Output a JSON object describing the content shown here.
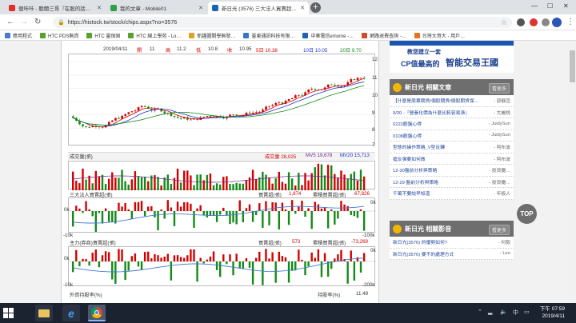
{
  "browser": {
    "tabs": [
      {
        "title": "個咔咔 - 聽爾三哥『在股的話…",
        "color": "#e52d27",
        "active": false
      },
      {
        "title": "我的文章 - Mobile01",
        "color": "#2f9e44",
        "active": false
      },
      {
        "title": "新日光 (3576) 三大法人買賣超…",
        "color": "#1b64b4",
        "active": true
      }
    ],
    "url": "https://histock.tw/stock/chips.aspx?no=3576",
    "bookmarks": [
      {
        "label": "應用程式",
        "color": "#4a7bd0"
      },
      {
        "label": "HTC PDS無資",
        "color": "#5aa02c"
      },
      {
        "label": "HTC 靈保固",
        "color": "#5aa02c"
      },
      {
        "label": "HTC 線上學苑 - Lo…",
        "color": "#5aa02c"
      },
      {
        "label": "新趣圖開學無發…",
        "color": "#e0a020"
      },
      {
        "label": "臺東通訊科技有限…",
        "color": "#3a73c9"
      },
      {
        "label": "中華電信emome -…",
        "color": "#1e61b8"
      },
      {
        "label": "網路退費查詢 -…",
        "color": "#d14b2f"
      },
      {
        "label": "台灣大哥大 - 用戶…",
        "color": "#e37222"
      }
    ]
  },
  "chart_header": {
    "date": "2019/04/11",
    "open_label": "開",
    "open": "11",
    "high_label": "高",
    "high": "11.2",
    "low_label": "低",
    "low": "10.8",
    "close_label": "收",
    "close": "10.95",
    "ma5": "5日 10.38",
    "ma10": "10日 10.05",
    "ma20": "20日 9.70"
  },
  "price_axis": [
    "12",
    "11",
    "10",
    "9",
    "8",
    "7",
    "6"
  ],
  "volume_panel": {
    "title": "成交量(張)",
    "vol": "成交量 28,025",
    "mv5": "MV5 19,678",
    "mv20": "MV20 15,713"
  },
  "institutional_panel": {
    "title": "三大法人買賣超(張)",
    "net_label": "買賣超(張)",
    "net_value": "1,874",
    "cum_label": "累積買賣超(張)",
    "cum_value": "67,826",
    "left_axis": "0k",
    "left_axis_low": "-10k",
    "right_axis": "0k",
    "right_axis_low": "-100k"
  },
  "major_panel": {
    "title": "主力(券商)買賣超(張)",
    "net_label": "買賣超(張)",
    "net_value": "573",
    "cum_label": "累積買賣超(張)",
    "cum_value": "-73,269",
    "left_axis": "0k",
    "left_axis_low": "-10k",
    "right_axis": "0k",
    "right_axis_low": "-200k"
  },
  "foreign_panel": {
    "title": "外資持股率(%)",
    "label": "持股率(%)",
    "value": "11.49"
  },
  "sidebar": {
    "banner_line1": "教您建立一套",
    "banner_line2": "CP值最高的",
    "banner_line3": "智能交易王國",
    "articles_title": "新日光 相關文章",
    "more": "看更多",
    "articles": [
      {
        "title": "【什麼是股票期貨/個股期貨/個股期貨保…",
        "author": "- 郭靜宜"
      },
      {
        "title": "9/20 -『營養化價為什麼比較容易漲』",
        "author": "- 大麗桃"
      },
      {
        "title": "0222觀盤心得",
        "author": "- JuidySun"
      },
      {
        "title": "0108觀盤心得",
        "author": "- JuidySun"
      },
      {
        "title": "型態的操作策略_V型反轉",
        "author": "- 阿布波"
      },
      {
        "title": "搶反彈要如何做",
        "author": "- 阿布波"
      },
      {
        "title": "12-30盤前分析與策略",
        "author": "- 投資攤…"
      },
      {
        "title": "12-29 盤前分析與策略",
        "author": "- 投資攤…"
      },
      {
        "title": "千萬不要說早知道",
        "author": "- 年殺人"
      }
    ],
    "videos_title": "新日光 相關影音",
    "videos": [
      {
        "title": "新日光(3576) 的優勢如何?",
        "author": "- 何毅"
      },
      {
        "title": "新日光(3576) 要不的處理方式",
        "author": "- Leo"
      }
    ],
    "top": "TOP"
  },
  "taskbar": {
    "time": "下午 07:59",
    "date": "2019/4/11"
  }
}
